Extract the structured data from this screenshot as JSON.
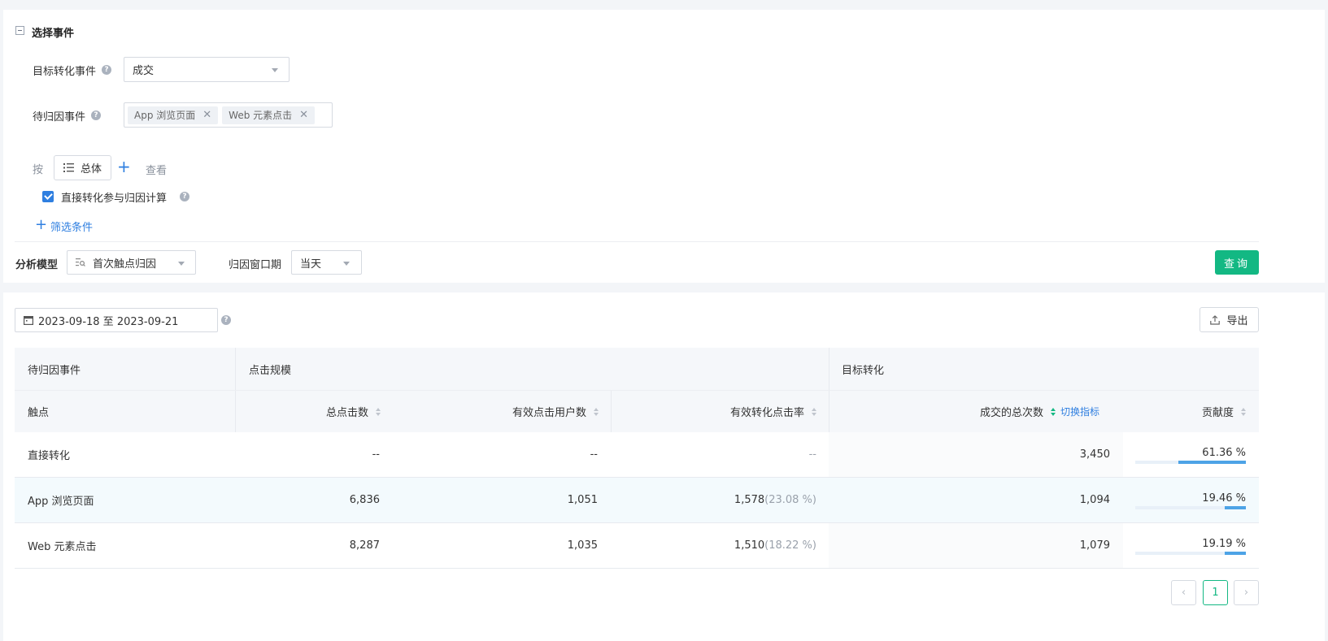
{
  "events_section": {
    "title": "选择事件",
    "target_event_label": "目标转化事件",
    "target_event_value": "成交",
    "attr_events_label": "待归因事件",
    "attr_events_tags": [
      "App 浏览页面",
      "Web 元素点击"
    ],
    "by_label": "按",
    "group_value": "总体",
    "view_label": "查看",
    "direct_conv_checkbox_label": "直接转化参与归因计算",
    "direct_conv_checked": true,
    "add_filter_label": "筛选条件",
    "help_symbol": "?"
  },
  "model_bar": {
    "model_label": "分析模型",
    "model_value": "首次触点归因",
    "window_label": "归因窗口期",
    "window_value": "当天",
    "query_button": "查询"
  },
  "results": {
    "date_range": "2023-09-18 至 2023-09-21",
    "export_label": "导出",
    "table": {
      "group_headers": [
        "待归因事件",
        "点击规模",
        "目标转化"
      ],
      "columns": [
        "触点",
        "总点击数",
        "有效点击用户数",
        "有效转化点击率",
        "成交的总次数",
        "贡献度"
      ],
      "switch_metric_label": "切换指标",
      "rows": [
        {
          "touchpoint": "直接转化",
          "total_clicks": "--",
          "valid_users": "--",
          "valid_rate": "--",
          "rate_pct": "",
          "deal_count": "3,450",
          "contribution": "61.36 %",
          "contribution_value": 61.36
        },
        {
          "touchpoint": "App 浏览页面",
          "total_clicks": "6,836",
          "valid_users": "1,051",
          "valid_rate": "1,578",
          "rate_pct": "(23.08 %)",
          "deal_count": "1,094",
          "contribution": "19.46 %",
          "contribution_value": 19.46
        },
        {
          "touchpoint": "Web 元素点击",
          "total_clicks": "8,287",
          "valid_users": "1,035",
          "valid_rate": "1,510",
          "rate_pct": "(18.22 %)",
          "deal_count": "1,079",
          "contribution": "19.19 %",
          "contribution_value": 19.19
        }
      ]
    },
    "pagination": {
      "current_page": "1",
      "prev": "‹",
      "next": "›"
    }
  },
  "colors": {
    "accent_green": "#13b883",
    "link_blue": "#2f7fe0",
    "bar_blue": "#4da3e6"
  }
}
